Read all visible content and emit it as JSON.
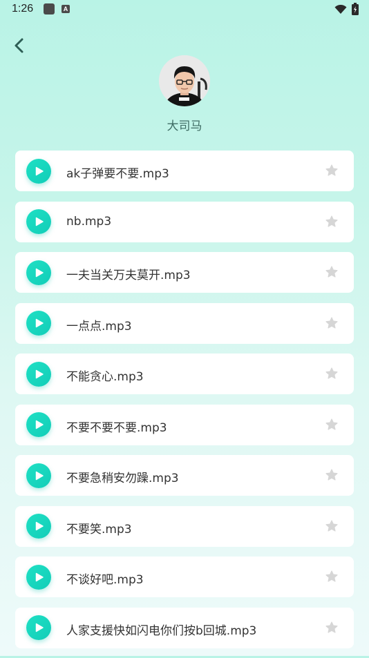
{
  "status_bar": {
    "time": "1:26",
    "icons": [
      "app-square-icon",
      "app-a-icon",
      "wifi-icon",
      "battery-icon"
    ],
    "app_a_letter": "A"
  },
  "header": {
    "back_icon": "chevron-left-icon",
    "user_name": "大司马",
    "avatar": "avatar-photo"
  },
  "colors": {
    "accent": "#14d2bc",
    "back_arrow": "#2d5e55",
    "name_text": "#3e6b63",
    "star_inactive": "#d6d6d6"
  },
  "tracks": [
    {
      "title": "ak子弹要不要.mp3",
      "favorited": false
    },
    {
      "title": "nb.mp3",
      "favorited": false
    },
    {
      "title": "一夫当关万夫莫开.mp3",
      "favorited": false
    },
    {
      "title": "一点点.mp3",
      "favorited": false
    },
    {
      "title": "不能贪心.mp3",
      "favorited": false
    },
    {
      "title": "不要不要不要.mp3",
      "favorited": false
    },
    {
      "title": "不要急稍安勿躁.mp3",
      "favorited": false
    },
    {
      "title": "不要笑.mp3",
      "favorited": false
    },
    {
      "title": "不谈好吧.mp3",
      "favorited": false
    },
    {
      "title": "人家支援快如闪电你们按b回城.mp3",
      "favorited": false
    }
  ]
}
